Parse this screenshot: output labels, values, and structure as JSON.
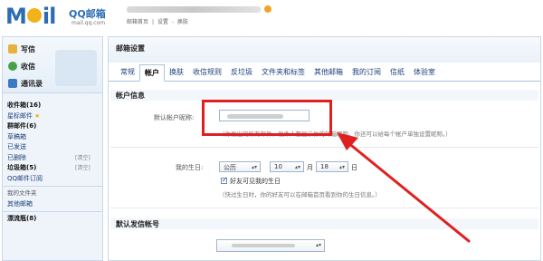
{
  "header": {
    "logo_text_1": "M",
    "logo_text_2": "il",
    "logo_qq": "QQ邮箱",
    "logo_url": "mail.qq.com",
    "links": [
      "邮箱首页",
      "|",
      "设置",
      "-",
      "换肤"
    ]
  },
  "sidebar": {
    "quick": [
      {
        "label": "写信",
        "icon": "pen-icon"
      },
      {
        "label": "收信",
        "icon": "receive-icon"
      },
      {
        "label": "通讯录",
        "icon": "address-book-icon"
      }
    ],
    "folders": [
      {
        "label": "收件箱",
        "count": "(16)",
        "bold": true
      },
      {
        "label": "星标邮件",
        "star": true
      },
      {
        "label": "群邮件",
        "count": "(6)",
        "bold": true
      },
      {
        "label": "草稿箱"
      },
      {
        "label": "已发送"
      },
      {
        "label": "已删除",
        "clear": "[清空]"
      },
      {
        "label": "垃圾箱",
        "count": "(5)",
        "bold": true,
        "clear": "[清空]"
      },
      {
        "label": "QQ邮件订阅"
      }
    ],
    "my_folders": "我的文件夹",
    "other_mail": "其他邮箱",
    "drift": {
      "label": "漂流瓶",
      "count": "(8)"
    }
  },
  "main": {
    "title": "邮箱设置",
    "tabs": [
      "常规",
      "帐户",
      "换肤",
      "收信规则",
      "反垃圾",
      "文件夹和标签",
      "其他邮箱",
      "我的订阅",
      "信纸",
      "体验室"
    ],
    "active_tab": 1,
    "account_section": "帐户信息",
    "default_nickname_label": "默认帐户昵称:",
    "nickname_hint": "（你发出的所有邮件，发件人都显示你的邮箱昵称，你还可以给每个帐户单独设置昵称。）",
    "birthday_label": "我的生日:",
    "birthday": {
      "calendar": "公历",
      "month": "10",
      "month_unit": "月",
      "day": "18",
      "day_unit": "日"
    },
    "birthday_visible_label": "好友可见我的生日",
    "birthday_visible_checked": true,
    "birthday_hint": "（快过生日时，你的好友可以在邮箱首页看到你的生日信息。）",
    "default_sender_section": "默认发信帐号"
  },
  "colors": {
    "highlight": "#e02020",
    "arrow": "#e02020",
    "brand": "#2b6cb5"
  }
}
